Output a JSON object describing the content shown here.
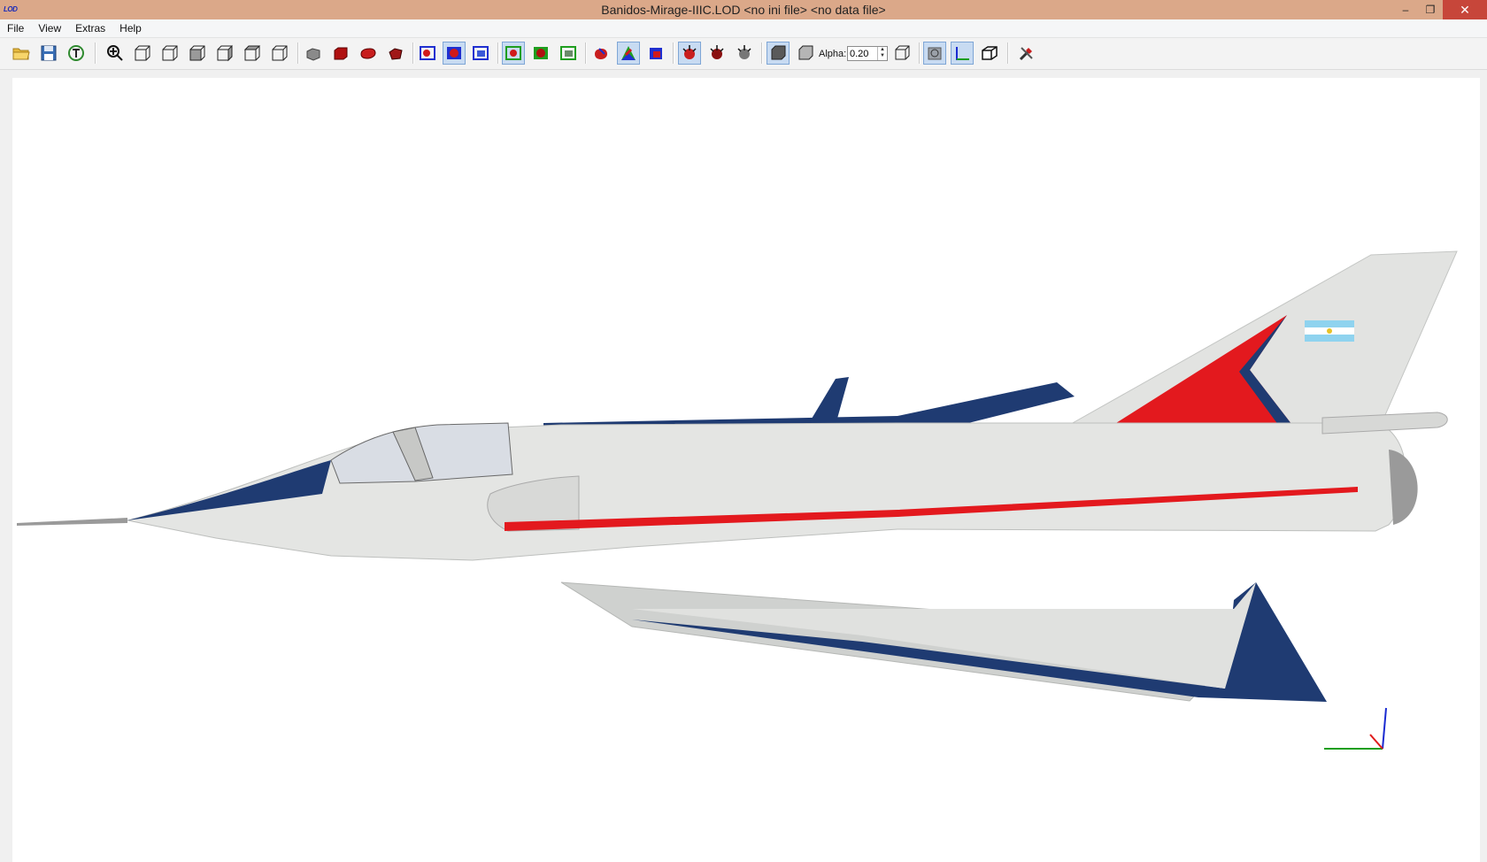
{
  "window": {
    "title": "Banidos-Mirage-IIIC.LOD  <no ini file>  <no data file>",
    "app_icon_text": "LOD",
    "minimize": "–",
    "restore": "❐",
    "close": "✕"
  },
  "menu": [
    "File",
    "View",
    "Extras",
    "Help"
  ],
  "toolbar": {
    "alpha_label": "Alpha:",
    "alpha_value": "0.20"
  },
  "colors": {
    "titlebar": "#dba889",
    "aircraft_body": "#e4e5e3",
    "aircraft_blue": "#1f3b72",
    "aircraft_red": "#e3191e",
    "axis_x": "#1b9e1b",
    "axis_y": "#1a2bd1",
    "axis_z": "#e01b1b"
  }
}
